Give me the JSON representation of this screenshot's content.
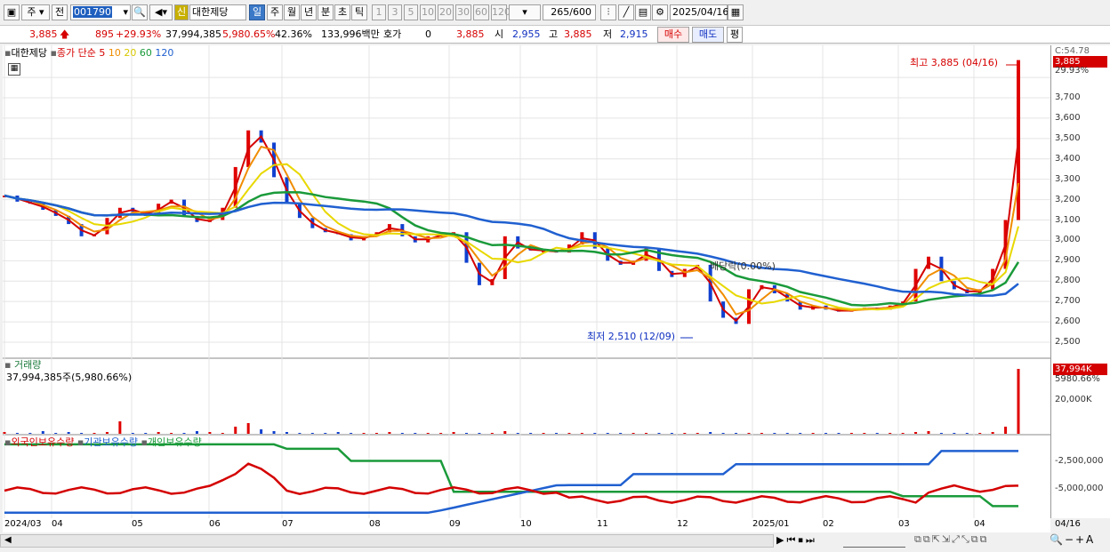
{
  "toolbar": {
    "market_label": "주",
    "prev_label": "전",
    "code_value": "001790",
    "new_badge": "신",
    "stock_name": "대한제당",
    "period_tabs": [
      "일",
      "주",
      "월",
      "년",
      "분",
      "초",
      "틱"
    ],
    "interval_buttons": [
      "1",
      "3",
      "5",
      "10",
      "20",
      "30",
      "60",
      "120"
    ],
    "count_value": "265",
    "count_total": "/600",
    "date_value": "2025/04/16"
  },
  "info": {
    "price": "3,885",
    "change": "895",
    "change_pct": "+29.93%",
    "volume": "37,994,385",
    "volume_ratio": "5,980.65%",
    "turnover": "42.36%",
    "amount": "133,996백만",
    "bid_label": "호가",
    "bid_value": "0",
    "ask_price": "3,885",
    "open_label": "시",
    "open_value": "2,955",
    "high_label": "고",
    "high_value": "3,885",
    "low_label": "저",
    "low_value": "2,915",
    "buy_label": "매수",
    "sell_label": "매도",
    "eval_label": "평"
  },
  "legend": {
    "stock": "대한제당",
    "price_label": "종가 단순",
    "ma": [
      "5",
      "10",
      "20",
      "60",
      "120"
    ],
    "ma_colors": [
      "#d40000",
      "#f08c00",
      "#e8d800",
      "#1a9a3a",
      "#2060d0"
    ],
    "volume_title": "거래량",
    "volume_text": "37,994,385주(5,980.66%)",
    "holdings": [
      "외국인보유수량",
      "기관보유수량",
      "개인보유수량"
    ],
    "holding_colors": [
      "#d40000",
      "#2060d0",
      "#1a9a3a"
    ]
  },
  "annotations": {
    "high": "최고 3,885 (04/16)",
    "low": "최저 2,510 (12/09)",
    "dividend": "배당락(0.00%)"
  },
  "price_axis": {
    "ticks": [
      "3,700",
      "3,600",
      "3,500",
      "3,400",
      "3,300",
      "3,200",
      "3,100",
      "3,000",
      "2,900",
      "2,800",
      "2,700",
      "2,600",
      "2,500"
    ],
    "top_partial": "3,800",
    "c_label": "C:54.78",
    "last_price": "3,885",
    "last_pct": "29.93%"
  },
  "volume_axis": {
    "tick": "20,000K",
    "last": "37,994K",
    "last_pct": "5980.66%"
  },
  "holding_axis": {
    "ticks": [
      "-2,500,000",
      "-5,000,000"
    ]
  },
  "x_axis": {
    "labels": [
      "2024/03",
      "04",
      "05",
      "06",
      "07",
      "08",
      "09",
      "10",
      "11",
      "12",
      "2025/01",
      "02",
      "03",
      "04"
    ],
    "right_label": "04/16"
  },
  "chart_data": {
    "type": "line",
    "title": "대한제당",
    "yrange": [
      2450,
      3900
    ],
    "months": [
      "2024/03",
      "04",
      "05",
      "06",
      "07",
      "08",
      "09",
      "10",
      "11",
      "12",
      "2025/01",
      "02",
      "03",
      "04"
    ],
    "close": [
      3220,
      3190,
      3180,
      3150,
      3120,
      3080,
      3020,
      3030,
      3110,
      3160,
      3140,
      3120,
      3180,
      3200,
      3120,
      3090,
      3100,
      3160,
      3360,
      3540,
      3480,
      3310,
      3180,
      3110,
      3060,
      3040,
      3030,
      3000,
      3020,
      3040,
      3080,
      3020,
      2990,
      3020,
      3030,
      3040,
      2890,
      2780,
      2810,
      3020,
      2960,
      2950,
      2950,
      2940,
      2980,
      3040,
      2960,
      2900,
      2880,
      2900,
      2960,
      2850,
      2820,
      2860,
      2880,
      2700,
      2620,
      2590,
      2760,
      2780,
      2740,
      2700,
      2660,
      2680,
      2660,
      2650,
      2660,
      2670,
      2660,
      2680,
      2700,
      2860,
      2920,
      2800,
      2760,
      2740,
      2760,
      2860,
      3100,
      3885
    ],
    "high": 3885,
    "low": 2510,
    "volume_last": 37994385,
    "holdings_foreign_end": -5000000,
    "holdings_institution_end": -2100000,
    "holdings_individual_end": -5100000
  }
}
